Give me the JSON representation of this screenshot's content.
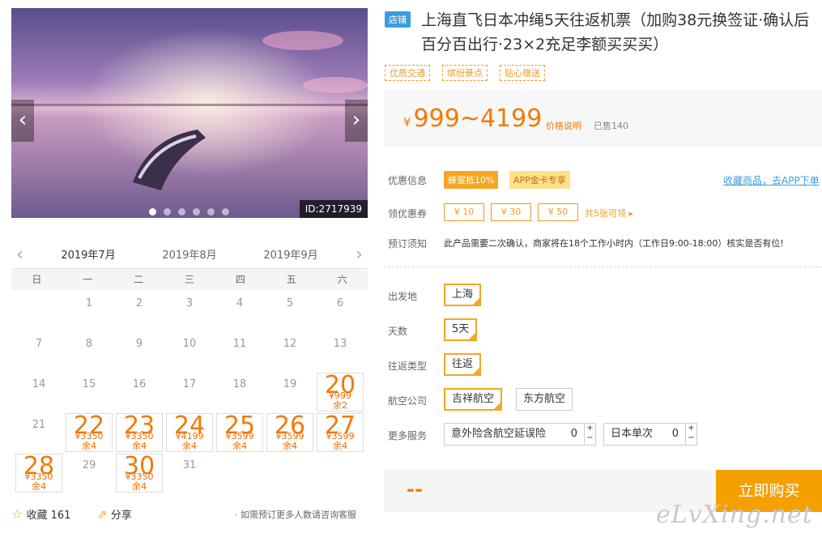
{
  "gallery": {
    "id_badge": "ID:2717939",
    "prev_glyph": "‹",
    "next_glyph": "›"
  },
  "calendar": {
    "months": [
      "2019年7月",
      "2019年8月",
      "2019年9月"
    ],
    "weekdays": [
      "日",
      "一",
      "二",
      "三",
      "四",
      "五",
      "六"
    ],
    "days": [
      {
        "d": "1"
      },
      {
        "d": "2"
      },
      {
        "d": "3"
      },
      {
        "d": "4"
      },
      {
        "d": "5"
      },
      {
        "d": "6"
      },
      {
        "d": "7"
      },
      {
        "d": "8"
      },
      {
        "d": "9"
      },
      {
        "d": "10"
      },
      {
        "d": "11"
      },
      {
        "d": "12"
      },
      {
        "d": "13"
      },
      {
        "d": "14"
      },
      {
        "d": "15"
      },
      {
        "d": "16"
      },
      {
        "d": "17"
      },
      {
        "d": "18"
      },
      {
        "d": "19"
      },
      {
        "d": "20",
        "p": "¥999",
        "r": "余2"
      },
      {
        "d": "21"
      },
      {
        "d": "22",
        "p": "¥3350",
        "r": "余4"
      },
      {
        "d": "23",
        "p": "¥3350",
        "r": "余4"
      },
      {
        "d": "24",
        "p": "¥4199",
        "r": "余4"
      },
      {
        "d": "25",
        "p": "¥3599",
        "r": "余4"
      },
      {
        "d": "26",
        "p": "¥3599",
        "r": "余4"
      },
      {
        "d": "27",
        "p": "¥3599",
        "r": "余4"
      },
      {
        "d": "28",
        "p": "¥3350",
        "r": "余4"
      },
      {
        "d": "29"
      },
      {
        "d": "30",
        "p": "¥3350",
        "r": "余4"
      },
      {
        "d": "31"
      }
    ],
    "first_weekday": 1
  },
  "footer": {
    "fav_label": "收藏",
    "fav_count": "161",
    "share_label": "分享",
    "note": "· 如需预订更多人数请咨询客服"
  },
  "product": {
    "shop_badge": "店铺",
    "title": "上海直飞日本冲绳5天往返机票（加购38元换签证·确认后百分百出行·23×2充足李额买买买）",
    "tags": [
      "优质交通",
      "缤纷景点",
      "贴心赠送"
    ],
    "price_symbol": "¥",
    "price": "999~4199",
    "price_note": "价格说明",
    "sold": "已售140"
  },
  "promo": {
    "label": "优惠信息",
    "hot": "蜂蜜抵10%",
    "gold": "APP金卡专享",
    "link": "收藏商品，去APP下单"
  },
  "coupons": {
    "label": "领优惠券",
    "items": [
      "¥ 10",
      "¥ 30",
      "¥ 50"
    ],
    "more": "共5张可领 ▸"
  },
  "notice": {
    "label": "预订须知",
    "text": "此产品需要二次确认，商家将在18个工作小时内（工作日9:00-18:00）核实是否有位!"
  },
  "options": {
    "departure_label": "出发地",
    "departure": "上海",
    "days_label": "天数",
    "days": "5天",
    "trip_label": "往返类型",
    "trip": "往返",
    "airline_label": "航空公司",
    "airlines": [
      "吉祥航空",
      "东方航空"
    ],
    "service_label": "更多服务",
    "services": [
      {
        "name": "意外险含航空延误险",
        "qty": "0"
      },
      {
        "name": "日本单次",
        "qty": "0"
      }
    ]
  },
  "buy": {
    "total": "--",
    "button": "立即购买"
  },
  "watermark": "eLvXing.net",
  "colors": {
    "accent": "#f5a000",
    "price": "#f27a05",
    "link": "#3b9ddd"
  }
}
